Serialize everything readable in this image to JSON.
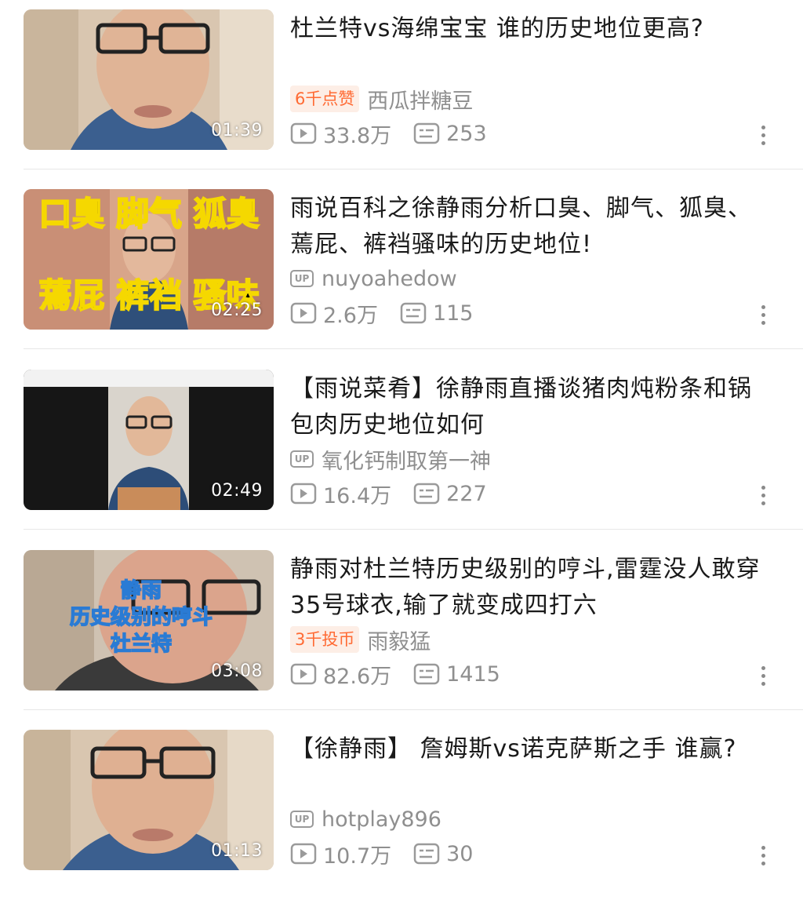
{
  "videos": [
    {
      "title": "杜兰特vs海绵宝宝 谁的历史地位更高?",
      "badge": "6千点赞",
      "author": "西瓜拌糖豆",
      "views": "33.8万",
      "comments": "253",
      "duration": "01:39"
    },
    {
      "title": "雨说百科之徐静雨分析口臭、脚气、狐臭、蔫屁、裤裆骚味的历史地位!",
      "badge": "",
      "author": "nuyoahedow",
      "views": "2.6万",
      "comments": "115",
      "duration": "02:25",
      "thumb_text_top": "口臭 脚气 狐臭",
      "thumb_text_bottom": "蔫屁 裤裆 骚味"
    },
    {
      "title": "【雨说菜肴】徐静雨直播谈猪肉炖粉条和锅包肉历史地位如何",
      "badge": "",
      "author": "氧化钙制取第一神",
      "views": "16.4万",
      "comments": "227",
      "duration": "02:49"
    },
    {
      "title": "静雨对杜兰特历史级别的哼斗,雷霆没人敢穿35号球衣,输了就变成四打六",
      "badge": "3千投币",
      "author": "雨毅猛",
      "views": "82.6万",
      "comments": "1415",
      "duration": "03:08",
      "thumb_lines": [
        "静雨",
        "历史级别的哼斗",
        "杜兰特"
      ]
    },
    {
      "title": "【徐静雨】 詹姆斯vs诺克萨斯之手 谁赢?",
      "badge": "",
      "author": "hotplay896",
      "views": "10.7万",
      "comments": "30",
      "duration": "01:13"
    }
  ],
  "up_label": "UP",
  "colors": {
    "badge_text": "#ff6a33",
    "badge_bg": "#fdeee6",
    "meta_gray": "#8f8f8f"
  }
}
